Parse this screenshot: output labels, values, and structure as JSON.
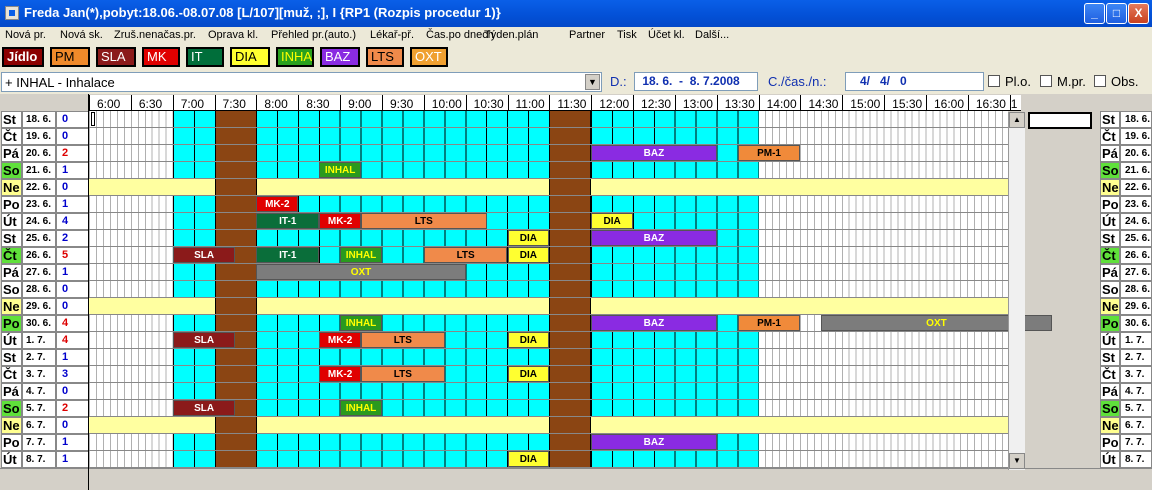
{
  "window": {
    "title": "Freda Jan(*),pobyt:18.06.-08.07.08 [L/107][muž, ;], I  {RP1 (Rozpis procedur 1)}",
    "minimize_label": "_",
    "maximize_label": "□",
    "close_label": "X"
  },
  "menu": [
    {
      "label": "Nová pr."
    },
    {
      "label": "Nová sk."
    },
    {
      "label": "Zruš.nenačas.pr."
    },
    {
      "label": "Oprava kl."
    },
    {
      "label": "Přehled pr.(auto.)"
    },
    {
      "label": "Lékař-př."
    },
    {
      "label": "Čas.po dnech"
    },
    {
      "label": "Týden.plán"
    },
    {
      "label": "Partner"
    },
    {
      "label": "Tisk"
    },
    {
      "label": "Účet kl."
    },
    {
      "label": "Další..."
    }
  ],
  "legend": [
    {
      "code": "Jídlo",
      "bg": "#8b0000",
      "fg": "#ffffff"
    },
    {
      "code": "PM",
      "bg": "#f08a2a",
      "fg": "#000000"
    },
    {
      "code": "SLA",
      "bg": "#8b1a1a",
      "fg": "#ffffff"
    },
    {
      "code": "MK",
      "bg": "#e00000",
      "fg": "#ffffff"
    },
    {
      "code": "IT",
      "bg": "#006e3a",
      "fg": "#ffffff"
    },
    {
      "code": "DIA",
      "bg": "#ffff30",
      "fg": "#000000"
    },
    {
      "code": "INHA",
      "bg": "#2aa11e",
      "fg": "#ffff00"
    },
    {
      "code": "BAZ",
      "bg": "#8a2be2",
      "fg": "#ffffff"
    },
    {
      "code": "LTS",
      "bg": "#f08a4a",
      "fg": "#000000"
    },
    {
      "code": "OXT",
      "bg": "#f0a030",
      "fg": "#ffffff"
    }
  ],
  "filter": {
    "procedure": "+ INHAL - Inhalace",
    "date_label": "D.:",
    "date_value": " 18. 6.  -  8. 7.2008",
    "count_label": "C./čas./n.:",
    "count_value": "   4/   4/   0",
    "checks": [
      {
        "label": "Pl.o."
      },
      {
        "label": "M.pr."
      },
      {
        "label": "Obs."
      }
    ]
  },
  "timeline": {
    "labels": [
      "6:00",
      "6:30",
      "7:00",
      "7:30",
      "8:00",
      "8:30",
      "9:00",
      "9:30",
      "10:00",
      "10:30",
      "11:00",
      "11:30",
      "12:00",
      "12:30",
      "13:00",
      "13:30",
      "14:00",
      "14:30",
      "15:00",
      "15:30",
      "16:00",
      "16:30",
      "1"
    ]
  },
  "days": [
    {
      "dow": "St",
      "date": "18. 6.",
      "count": "0",
      "count_color": "#0000cc",
      "kind": "work"
    },
    {
      "dow": "Čt",
      "date": "19. 6.",
      "count": "0",
      "count_color": "#0000cc",
      "kind": "work"
    },
    {
      "dow": "Pá",
      "date": "20. 6.",
      "count": "2",
      "count_color": "#dd0000",
      "kind": "work"
    },
    {
      "dow": "So",
      "date": "21. 6.",
      "count": "1",
      "count_color": "#0000cc",
      "kind": "sat"
    },
    {
      "dow": "Ne",
      "date": "22. 6.",
      "count": "0",
      "count_color": "#0000cc",
      "kind": "sun"
    },
    {
      "dow": "Po",
      "date": "23. 6.",
      "count": "1",
      "count_color": "#0000cc",
      "kind": "work"
    },
    {
      "dow": "Út",
      "date": "24. 6.",
      "count": "4",
      "count_color": "#0000cc",
      "kind": "work"
    },
    {
      "dow": "St",
      "date": "25. 6.",
      "count": "2",
      "count_color": "#0000cc",
      "kind": "work"
    },
    {
      "dow": "Čt",
      "date": "26. 6.",
      "count": "5",
      "count_color": "#dd0000",
      "kind": "sat"
    },
    {
      "dow": "Pá",
      "date": "27. 6.",
      "count": "1",
      "count_color": "#0000cc",
      "kind": "work"
    },
    {
      "dow": "So",
      "date": "28. 6.",
      "count": "0",
      "count_color": "#0000cc",
      "kind": "work"
    },
    {
      "dow": "Ne",
      "date": "29. 6.",
      "count": "0",
      "count_color": "#0000cc",
      "kind": "sun"
    },
    {
      "dow": "Po",
      "date": "30. 6.",
      "count": "4",
      "count_color": "#dd0000",
      "kind": "sat"
    },
    {
      "dow": "Út",
      "date": "1. 7.",
      "count": "4",
      "count_color": "#dd0000",
      "kind": "work"
    },
    {
      "dow": "St",
      "date": "2. 7.",
      "count": "1",
      "count_color": "#0000cc",
      "kind": "work"
    },
    {
      "dow": "Čt",
      "date": "3. 7.",
      "count": "3",
      "count_color": "#0000cc",
      "kind": "work"
    },
    {
      "dow": "Pá",
      "date": "4. 7.",
      "count": "0",
      "count_color": "#0000cc",
      "kind": "work"
    },
    {
      "dow": "So",
      "date": "5. 7.",
      "count": "2",
      "count_color": "#dd0000",
      "kind": "sat"
    },
    {
      "dow": "Ne",
      "date": "6. 7.",
      "count": "0",
      "count_color": "#0000cc",
      "kind": "sun"
    },
    {
      "dow": "Po",
      "date": "7. 7.",
      "count": "1",
      "count_color": "#0000cc",
      "kind": "work"
    },
    {
      "dow": "Út",
      "date": "8. 7.",
      "count": "1",
      "count_color": "#0000cc",
      "kind": "work"
    }
  ],
  "appointments": [
    {
      "day": 2,
      "start": "12:00",
      "end": "13:30",
      "code": "BAZ"
    },
    {
      "day": 2,
      "start": "13:45",
      "end": "14:30",
      "code": "PM-1"
    },
    {
      "day": 3,
      "start": "8:45",
      "end": "9:15",
      "code": "INHAL"
    },
    {
      "day": 5,
      "start": "8:00",
      "end": "8:30",
      "code": "MK-2"
    },
    {
      "day": 6,
      "start": "8:00",
      "end": "8:45",
      "code": "IT-1"
    },
    {
      "day": 6,
      "start": "8:45",
      "end": "9:15",
      "code": "MK-2"
    },
    {
      "day": 6,
      "start": "9:15",
      "end": "10:45",
      "code": "LTS"
    },
    {
      "day": 6,
      "start": "12:00",
      "end": "12:30",
      "code": "DIA"
    },
    {
      "day": 7,
      "start": "11:00",
      "end": "11:30",
      "code": "DIA"
    },
    {
      "day": 7,
      "start": "12:00",
      "end": "13:30",
      "code": "BAZ"
    },
    {
      "day": 8,
      "start": "7:00",
      "end": "7:45",
      "code": "SLA"
    },
    {
      "day": 8,
      "start": "8:00",
      "end": "8:45",
      "code": "IT-1"
    },
    {
      "day": 8,
      "start": "9:00",
      "end": "9:30",
      "code": "INHAL"
    },
    {
      "day": 8,
      "start": "10:00",
      "end": "11:00",
      "code": "LTS"
    },
    {
      "day": 8,
      "start": "11:00",
      "end": "11:30",
      "code": "DIA"
    },
    {
      "day": 9,
      "start": "8:00",
      "end": "10:30",
      "code": "OXT"
    },
    {
      "day": 12,
      "start": "9:00",
      "end": "9:30",
      "code": "INHAL"
    },
    {
      "day": 12,
      "start": "12:00",
      "end": "13:30",
      "code": "BAZ"
    },
    {
      "day": 12,
      "start": "13:45",
      "end": "14:30",
      "code": "PM-1"
    },
    {
      "day": 12,
      "start": "14:45",
      "end": "17:30",
      "code": "OXT"
    },
    {
      "day": 13,
      "start": "7:00",
      "end": "7:45",
      "code": "SLA"
    },
    {
      "day": 13,
      "start": "8:45",
      "end": "9:15",
      "code": "MK-2"
    },
    {
      "day": 13,
      "start": "9:15",
      "end": "10:15",
      "code": "LTS"
    },
    {
      "day": 13,
      "start": "11:00",
      "end": "11:30",
      "code": "DIA"
    },
    {
      "day": 15,
      "start": "8:45",
      "end": "9:15",
      "code": "MK-2"
    },
    {
      "day": 15,
      "start": "9:15",
      "end": "10:15",
      "code": "LTS"
    },
    {
      "day": 15,
      "start": "11:00",
      "end": "11:30",
      "code": "DIA"
    },
    {
      "day": 17,
      "start": "7:00",
      "end": "7:45",
      "code": "SLA"
    },
    {
      "day": 17,
      "start": "9:00",
      "end": "9:30",
      "code": "INHAL"
    },
    {
      "day": 19,
      "start": "12:00",
      "end": "13:30",
      "code": "BAZ"
    },
    {
      "day": 20,
      "start": "11:00",
      "end": "11:30",
      "code": "DIA"
    }
  ],
  "appointment_colors": {
    "BAZ": {
      "bg": "#8a2be2",
      "fg": "#ffffff"
    },
    "PM-1": {
      "bg": "#f08a3a",
      "fg": "#000000"
    },
    "INHAL": {
      "bg": "#2a9a1e",
      "fg": "#ffff00"
    },
    "MK-2": {
      "bg": "#e00000",
      "fg": "#ffffff"
    },
    "IT-1": {
      "bg": "#0a6e3a",
      "fg": "#ffffff"
    },
    "LTS": {
      "bg": "#f08a4a",
      "fg": "#000000"
    },
    "DIA": {
      "bg": "#ffff30",
      "fg": "#000000"
    },
    "SLA": {
      "bg": "#8b1a1a",
      "fg": "#ffffff"
    },
    "OXT": {
      "bg": "#7c7c7c",
      "fg": "#ffff00"
    }
  },
  "colors": {
    "slot_open": "#00ffff",
    "slot_closed": "#ffffff",
    "meal": "#8b4513",
    "weekend_row": "#ffffa0",
    "sat_label": "#5fe03a",
    "sun_label": "#ffff90"
  }
}
